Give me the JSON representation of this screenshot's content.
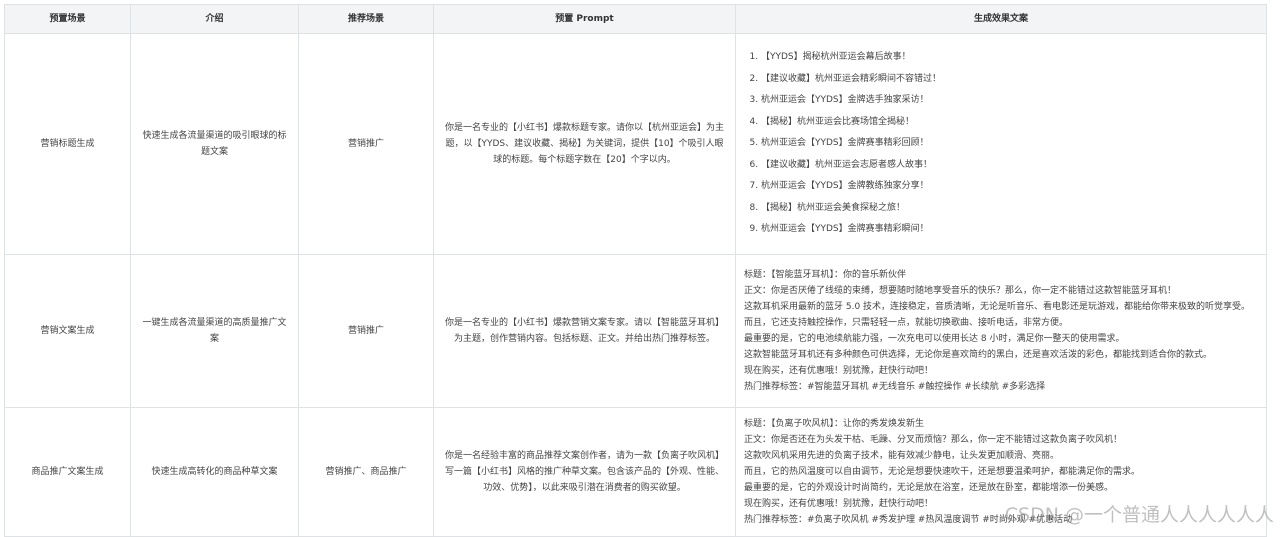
{
  "table": {
    "headers": [
      "预置场景",
      "介绍",
      "推荐场景",
      "预置 Prompt",
      "生成效果文案"
    ],
    "rows": [
      {
        "scene": "营销标题生成",
        "intro": "快速生成各流量渠道的吸引眼球的标题文案",
        "recommend": "营销推广",
        "prompt": "你是一名专业的【小红书】爆款标题专家。请你以【杭州亚运会】为主题，以【YYDS、建议收藏、揭秘】为关键词，提供【10】个吸引人眼球的标题。每个标题字数在【20】个字以内。",
        "results": [
          "【YYDS】揭秘杭州亚运会幕后故事！",
          "【建议收藏】杭州亚运会精彩瞬间不容错过！",
          "杭州亚运会【YYDS】金牌选手独家采访！",
          "【揭秘】杭州亚运会比赛场馆全揭秘！",
          "杭州亚运会【YYDS】金牌赛事精彩回顾！",
          "【建议收藏】杭州亚运会志愿者感人故事！",
          "杭州亚运会【YYDS】金牌教练独家分享！",
          "【揭秘】杭州亚运会美食探秘之旅！",
          "杭州亚运会【YYDS】金牌赛事精彩瞬间！"
        ]
      },
      {
        "scene": "营销文案生成",
        "intro": "一键生成各流量渠道的高质量推广文案",
        "recommend": "营销推广",
        "prompt": "你是一名专业的【小红书】爆款营销文案专家。请以【智能蓝牙耳机】为主题，创作营销内容。包括标题、正文。并给出热门推荐标签。",
        "lines": [
          "标题：【智能蓝牙耳机】：你的音乐新伙伴",
          "正文：你是否厌倦了线缆的束缚，想要随时随地享受音乐的快乐？那么，你一定不能错过这款智能蓝牙耳机！",
          "这款耳机采用最新的蓝牙 5.0 技术，连接稳定，音质清晰，无论是听音乐、看电影还是玩游戏，都能给你带来极致的听觉享受。",
          "而且，它还支持触控操作，只需轻轻一点，就能切换歌曲、接听电话，非常方便。",
          "最重要的是，它的电池续航能力强，一次充电可以使用长达 8 小时，满足你一整天的使用需求。",
          "这款智能蓝牙耳机还有多种颜色可供选择，无论你是喜欢简约的黑白，还是喜欢活泼的彩色，都能找到适合你的款式。",
          "现在购买，还有优惠哦！别犹豫，赶快行动吧！",
          "热门推荐标签：#智能蓝牙耳机 #无线音乐 #触控操作 #长续航 #多彩选择"
        ]
      },
      {
        "scene": "商品推广文案生成",
        "intro": "快速生成高转化的商品种草文案",
        "recommend": "营销推广、商品推广",
        "prompt": "你是一名经验丰富的商品推荐文案创作者，请为一款【负离子吹风机】写一篇【小红书】风格的推广种草文案。包含该产品的【外观、性能、功效、优势】，以此来吸引潜在消费者的购买欲望。",
        "lines": [
          "标题：【负离子吹风机】：让你的秀发焕发新生",
          "正文：你是否还在为头发干枯、毛躁、分叉而烦恼？那么，你一定不能错过这款负离子吹风机！",
          "这款吹风机采用先进的负离子技术，能有效减少静电，让头发更加顺滑、亮丽。",
          "而且，它的热风温度可以自由调节，无论是想要快速吹干，还是想要温柔呵护，都能满足你的需求。",
          "最重要的是，它的外观设计时尚简约，无论是放在浴室，还是放在卧室，都能增添一份美感。",
          "现在购买，还有优惠哦！别犹豫，赶快行动吧！",
          "热门推荐标签：#负离子吹风机 #秀发护理 #热风温度调节 #时尚外观 #优惠活动"
        ]
      }
    ]
  },
  "watermark": "CSDN @一个普通人人人人人人"
}
